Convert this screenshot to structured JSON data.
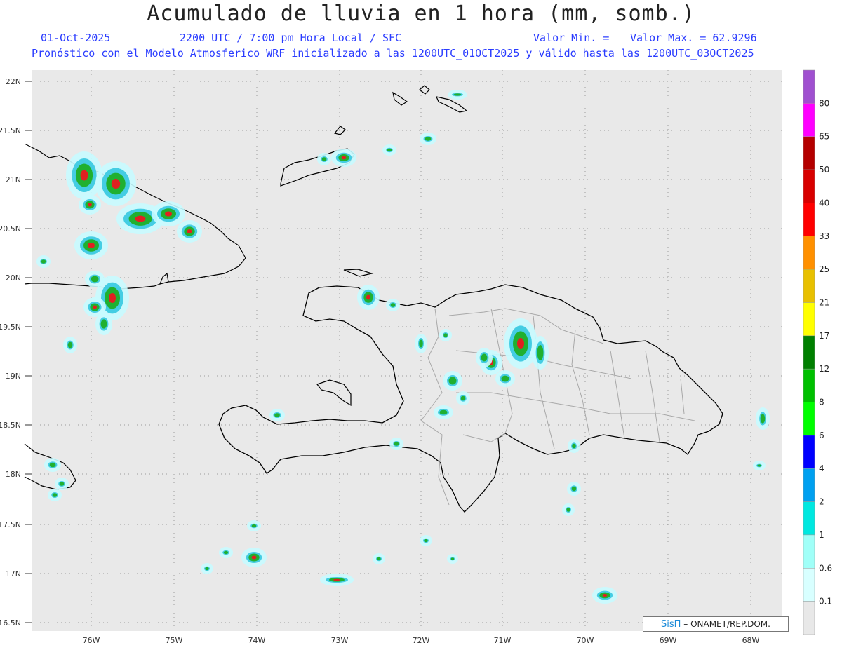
{
  "header": {
    "title": "Acumulado de lluvia en 1 hora (mm, somb.)",
    "date": "01-Oct-2025",
    "time_line": "2200 UTC / 7:00 pm Hora Local / SFC",
    "valor_min": "Valor Min. =",
    "valor_max": "Valor Max. = 62.9296",
    "forecast_line": "Pronóstico con el Modelo Atmosferico WRF inicializado a las 1200UTC_01OCT2025 y válido hasta las  1200UTC_03OCT2025"
  },
  "map": {
    "lon_labels": [
      "76W",
      "75W",
      "74W",
      "73W",
      "72W",
      "71W",
      "70W",
      "69W",
      "68W"
    ],
    "lat_labels": [
      "22N",
      "21.5N",
      "21N",
      "20.5N",
      "20N",
      "19.5N",
      "19N",
      "18.5N",
      "18N",
      "17.5N",
      "17N",
      "16.5N"
    ],
    "colors": {
      "land_fill": "#ebebeb",
      "coast": "#000000",
      "borders": "#aaaaaa",
      "grid": "#aaaaaa"
    }
  },
  "legend": {
    "colors": [
      "#e8e8e8",
      "#d8ffff",
      "#a0fff8",
      "#00e8e0",
      "#00a0f0",
      "#0000ff",
      "#00ff00",
      "#00c000",
      "#008000",
      "#ffff00",
      "#e8c000",
      "#ff9000",
      "#ff0000",
      "#d80000",
      "#b40000",
      "#ff00ff",
      "#a050d0"
    ],
    "labels": [
      "0.1",
      "0.6",
      "1",
      "2",
      "4",
      "6",
      "8",
      "12",
      "17",
      "21",
      "25",
      "33",
      "40",
      "50",
      "65",
      "80"
    ]
  },
  "credit": {
    "brand": "SisΠ",
    "text": " – ONAMET/REP.DOM."
  }
}
